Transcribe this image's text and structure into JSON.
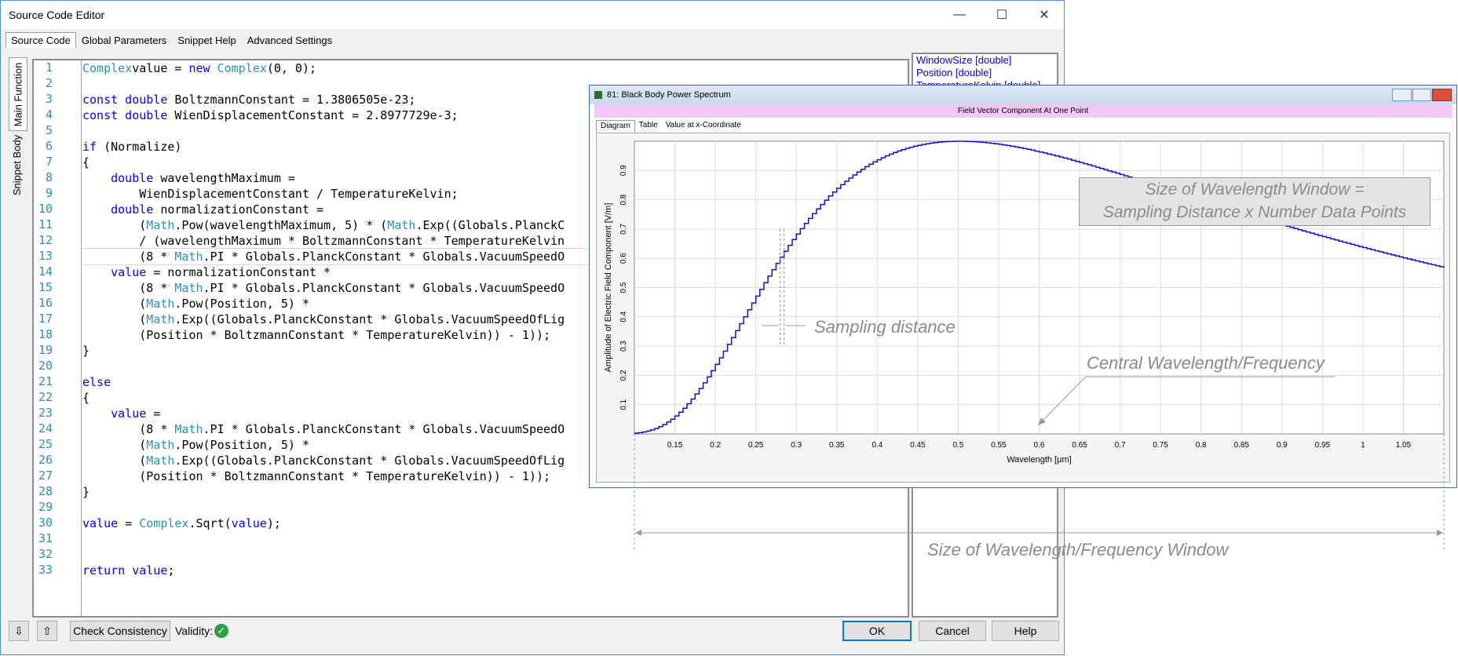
{
  "window": {
    "title": "Source Code Editor",
    "minimize": "—",
    "maximize": "☐",
    "close": "✕"
  },
  "tabs": [
    "Source Code",
    "Global Parameters",
    "Snippet Help",
    "Advanced Settings"
  ],
  "side_tabs": [
    "Main Function",
    "Snippet Body"
  ],
  "code_lines": [
    [
      [
        "ty",
        "Complex"
      ],
      [
        "",
        "value = "
      ],
      [
        "kw",
        "new "
      ],
      [
        "ty",
        "Complex"
      ],
      [
        "",
        "(0, 0);"
      ]
    ],
    [
      [
        "",
        ""
      ]
    ],
    [
      [
        "kw",
        "const double "
      ],
      [
        "",
        "BoltzmannConstant = 1.3806505e-23;"
      ]
    ],
    [
      [
        "kw",
        "const double "
      ],
      [
        "",
        "WienDisplacementConstant = 2.8977729e-3;"
      ]
    ],
    [
      [
        "",
        ""
      ]
    ],
    [
      [
        "kw",
        "if "
      ],
      [
        "",
        "(Normalize)"
      ]
    ],
    [
      [
        "",
        "{"
      ]
    ],
    [
      [
        "",
        "    "
      ],
      [
        "kw",
        "double "
      ],
      [
        "",
        "wavelengthMaximum ="
      ]
    ],
    [
      [
        "",
        "        WienDisplacementConstant / TemperatureKelvin;"
      ]
    ],
    [
      [
        "",
        "    "
      ],
      [
        "kw",
        "double "
      ],
      [
        "",
        "normalizationConstant ="
      ]
    ],
    [
      [
        "",
        "        ("
      ],
      [
        "ty",
        "Math"
      ],
      [
        "",
        ".Pow(wavelengthMaximum, 5) * ("
      ],
      [
        "ty",
        "Math"
      ],
      [
        "",
        ".Exp((Globals.PlanckC"
      ]
    ],
    [
      [
        "",
        "        / (wavelengthMaximum * BoltzmannConstant * TemperatureKelvin"
      ]
    ],
    [
      [
        "",
        "        (8 * "
      ],
      [
        "ty",
        "Math"
      ],
      [
        "",
        ".PI * Globals.PlanckConstant * Globals.VacuumSpeedO"
      ]
    ],
    [
      [
        "",
        "    "
      ],
      [
        "kw",
        "value "
      ],
      [
        "",
        "= normalizationConstant *"
      ]
    ],
    [
      [
        "",
        "        (8 * "
      ],
      [
        "ty",
        "Math"
      ],
      [
        "",
        ".PI * Globals.PlanckConstant * Globals.VacuumSpeedO"
      ]
    ],
    [
      [
        "",
        "        ("
      ],
      [
        "ty",
        "Math"
      ],
      [
        "",
        ".Pow(Position, 5) *"
      ]
    ],
    [
      [
        "",
        "        ("
      ],
      [
        "ty",
        "Math"
      ],
      [
        "",
        ".Exp((Globals.PlanckConstant * Globals.VacuumSpeedOfLig"
      ]
    ],
    [
      [
        "",
        "        (Position * BoltzmannConstant * TemperatureKelvin)) - 1));"
      ]
    ],
    [
      [
        "",
        "}"
      ]
    ],
    [
      [
        "",
        ""
      ]
    ],
    [
      [
        "kw",
        "else"
      ]
    ],
    [
      [
        "",
        "{"
      ]
    ],
    [
      [
        "",
        "    "
      ],
      [
        "kw",
        "value "
      ],
      [
        "",
        "="
      ]
    ],
    [
      [
        "",
        "        (8 * "
      ],
      [
        "ty",
        "Math"
      ],
      [
        "",
        ".PI * Globals.PlanckConstant * Globals.VacuumSpeedO"
      ]
    ],
    [
      [
        "",
        "        ("
      ],
      [
        "ty",
        "Math"
      ],
      [
        "",
        ".Pow(Position, 5) *"
      ]
    ],
    [
      [
        "",
        "        ("
      ],
      [
        "ty",
        "Math"
      ],
      [
        "",
        ".Exp((Globals.PlanckConstant * Globals.VacuumSpeedOfLig"
      ]
    ],
    [
      [
        "",
        "        (Position * BoltzmannConstant * TemperatureKelvin)) - 1));"
      ]
    ],
    [
      [
        "",
        "}"
      ]
    ],
    [
      [
        "",
        ""
      ]
    ],
    [
      [
        "kw",
        "value "
      ],
      [
        "",
        "= "
      ],
      [
        "ty",
        "Complex"
      ],
      [
        "",
        ".Sqrt("
      ],
      [
        "kw",
        "value"
      ],
      [
        "",
        ");"
      ]
    ],
    [
      [
        "",
        ""
      ]
    ],
    [
      [
        "",
        ""
      ]
    ],
    [
      [
        "kw",
        "return value"
      ],
      [
        "",
        ";"
      ]
    ]
  ],
  "params": [
    "WindowSize [double]",
    "Position [double]",
    "TemperatureKelvin [double]"
  ],
  "bottom": {
    "check": "Check Consistency",
    "validity": "Validity:",
    "ok": "OK",
    "cancel": "Cancel",
    "help": "Help"
  },
  "overlay": {
    "title": "81: Black Body Power Spectrum",
    "banner": "Field Vector Component At One Point",
    "tabs": [
      "Diagram",
      "Table",
      "Value at x-Coordinate"
    ]
  },
  "chart_data": {
    "type": "line",
    "xlabel": "Wavelength [µm]",
    "ylabel": "Amplitude of Electric Field Component [V/m]",
    "xlim": [
      0.1,
      1.1
    ],
    "ylim": [
      0,
      1.0
    ],
    "xticks": [
      0.15,
      0.2,
      0.25,
      0.3,
      0.35,
      0.4,
      0.45,
      0.5,
      0.55,
      0.6,
      0.65,
      0.7,
      0.75,
      0.8,
      0.85,
      0.9,
      0.95,
      1,
      1.05
    ],
    "yticks": [
      0.1,
      0.2,
      0.3,
      0.4,
      0.5,
      0.6,
      0.7,
      0.8,
      0.9
    ],
    "xtick_labels": [
      "0.15",
      "0.2",
      "0.25",
      "0.3",
      "0.35",
      "0.4",
      "0.45",
      "0.5",
      "0.55",
      "0.6",
      "0.65",
      "0.7",
      "0.75",
      "0.8",
      "0.85",
      "0.9",
      "0.95",
      "1",
      "1.05"
    ],
    "ytick_labels": [
      "0.1",
      "0.2",
      "0.3",
      "0.4",
      "0.5",
      "0.6",
      "0.7",
      "0.8",
      "0.9"
    ],
    "peak_wavelength": 0.5,
    "series_color": "#1010d0",
    "grid": true
  },
  "annotations": {
    "window_box": [
      "Size of Wavelength Window =",
      "Sampling Distance x Number Data Points"
    ],
    "sampling": "Sampling distance",
    "central": "Central Wavelength/Frequency",
    "size": "Size of Wavelength/Frequency Window"
  }
}
